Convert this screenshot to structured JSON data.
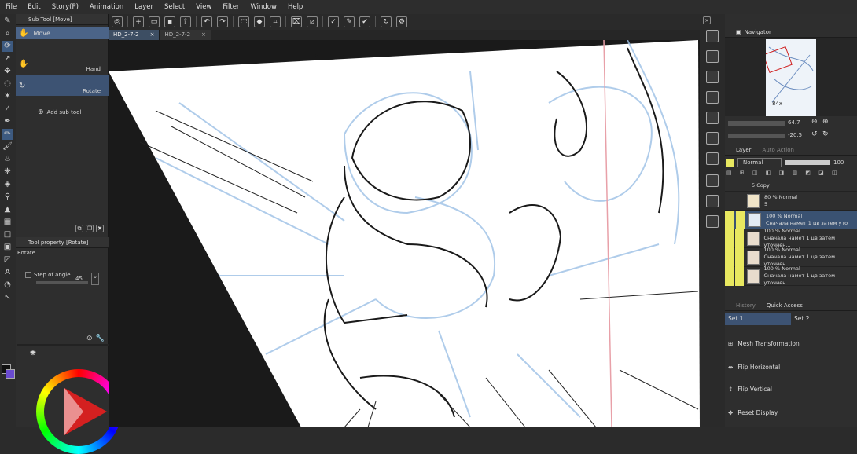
{
  "menu": [
    "File",
    "Edit",
    "Story(P)",
    "Animation",
    "Layer",
    "Select",
    "View",
    "Filter",
    "Window",
    "Help"
  ],
  "tabs": [
    {
      "label": "HD_2-7-2",
      "close": "×"
    },
    {
      "label": "HD_2-7-2",
      "close": "×"
    }
  ],
  "subtool": {
    "panel_title": "Sub Tool [Move]",
    "items": [
      {
        "label": "Move"
      },
      {
        "label": "Hand"
      },
      {
        "label": "Rotate"
      }
    ],
    "add_label": "Add sub tool"
  },
  "toolprop": {
    "panel_title": "Tool property [Rotate]",
    "name": "Rotate",
    "step_label": "Step of angle",
    "step_value": "45"
  },
  "navigator": {
    "title": "Navigator",
    "zoom": "84x",
    "zoom_value": "64.7",
    "angle_value": "-20.5"
  },
  "layer": {
    "tab_layer": "Layer",
    "tab_auto": "Auto Action",
    "blend": "Normal",
    "opacity": "100",
    "rows": [
      {
        "line1": "5 Copy",
        "line2": ""
      },
      {
        "line1": "80 % Normal",
        "line2": "5"
      },
      {
        "line1": "100 % Normal",
        "line2": "Сначала намет 1 цв затем уто"
      },
      {
        "line1": "100 % Normal",
        "line2": "Сначала намет 1 цв затем уточнен..."
      },
      {
        "line1": "100 % Normal",
        "line2": "Сначала намет 1 цв затем уточнен..."
      },
      {
        "line1": "100 % Normal",
        "line2": "Сначала намет 1 цв затем уточнен..."
      }
    ]
  },
  "quick_access": {
    "tab_history": "History",
    "tab_quick": "Quick Access",
    "set1": "Set 1",
    "set2": "Set 2",
    "items": [
      {
        "label": "Mesh Transformation"
      },
      {
        "label": "Flip Horizontal"
      },
      {
        "label": "Flip Vertical"
      },
      {
        "label": "Reset Display"
      }
    ]
  },
  "colors": {
    "accent": "#5a7aa8",
    "highlight": "#e8e860",
    "canvas_blue": "#9cc0e6"
  }
}
